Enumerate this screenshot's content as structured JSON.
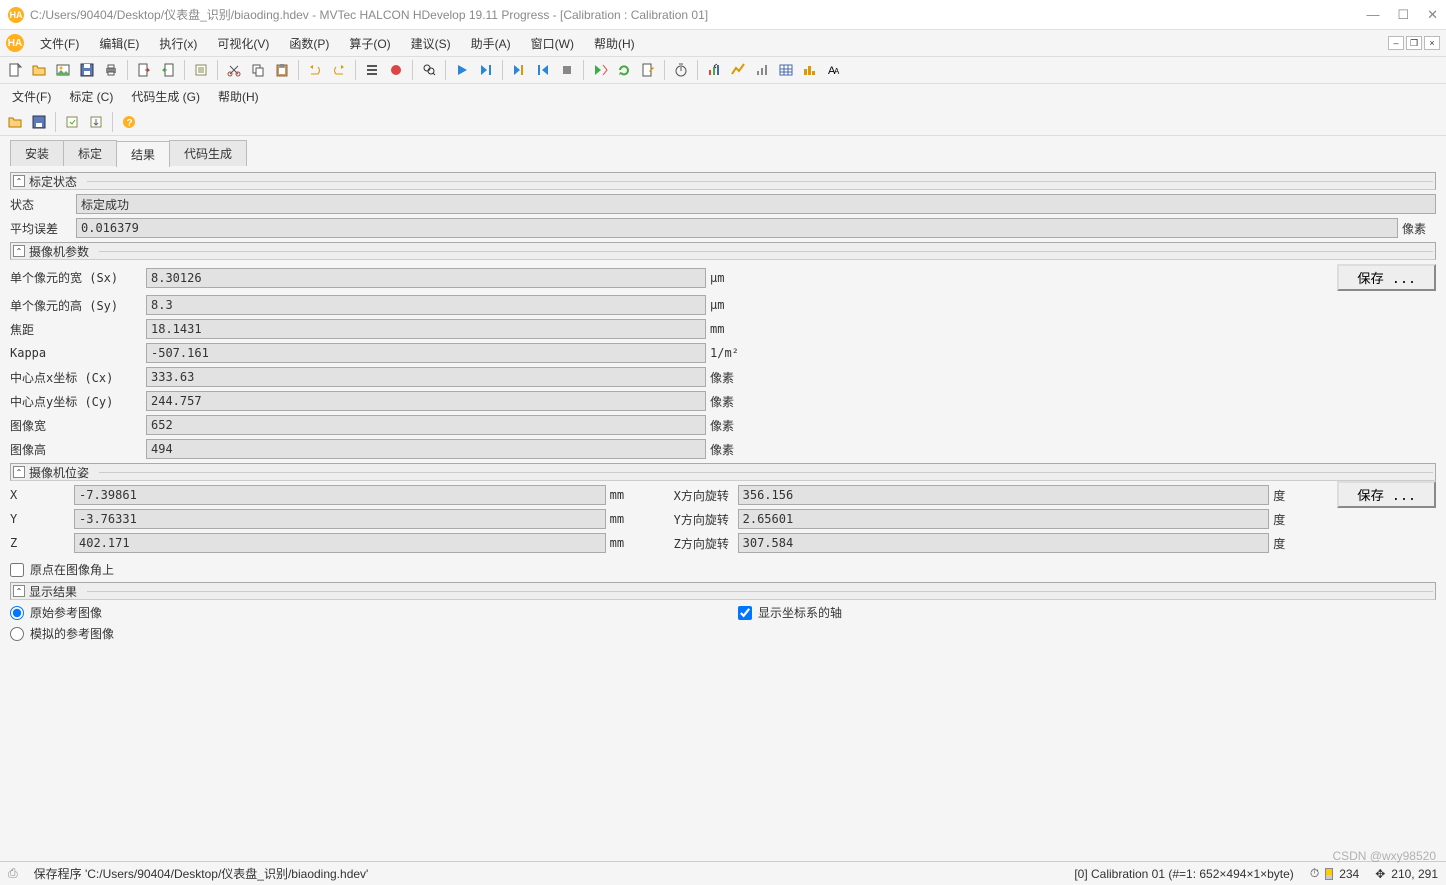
{
  "titlebar": {
    "title": "C:/Users/90404/Desktop/仪表盘_识别/biaoding.hdev - MVTec HALCON HDevelop 19.11 Progress - [Calibration : Calibration 01]"
  },
  "menus": {
    "file": "文件(F)",
    "edit": "编辑(E)",
    "exec": "执行(x)",
    "visual": "可视化(V)",
    "func": "函数(P)",
    "oper": "算子(O)",
    "suggest": "建议(S)",
    "assist": "助手(A)",
    "window": "窗口(W)",
    "help": "帮助(H)"
  },
  "submenu": {
    "file": "文件(F)",
    "calib": "标定 (C)",
    "codegen": "代码生成 (G)",
    "help": "帮助(H)"
  },
  "tabs": {
    "install": "安装",
    "calib": "标定",
    "result": "结果",
    "codegen": "代码生成"
  },
  "groups": {
    "calib_state": "标定状态",
    "cam_params": "摄像机参数",
    "cam_pose": "摄像机位姿",
    "display": "显示结果"
  },
  "state": {
    "label": "状态",
    "value": "标定成功",
    "err_label": "平均误差",
    "err_value": "0.016379",
    "err_unit": "像素"
  },
  "params": {
    "save": "保存 ...",
    "rows": [
      {
        "label": "单个像元的宽 (Sx)",
        "value": "8.30126",
        "unit": "μm"
      },
      {
        "label": "单个像元的高 (Sy)",
        "value": "8.3",
        "unit": "μm"
      },
      {
        "label": "焦距",
        "value": "18.1431",
        "unit": "mm"
      },
      {
        "label": "Kappa",
        "value": "-507.161",
        "unit": "1/m²"
      },
      {
        "label": "中心点x坐标 (Cx)",
        "value": "333.63",
        "unit": "像素"
      },
      {
        "label": "中心点y坐标 (Cy)",
        "value": "244.757",
        "unit": "像素"
      },
      {
        "label": "图像宽",
        "value": "652",
        "unit": "像素"
      },
      {
        "label": "图像高",
        "value": "494",
        "unit": "像素"
      }
    ]
  },
  "pose": {
    "save": "保存 ...",
    "left": [
      {
        "label": "X",
        "value": "-7.39861",
        "unit": "mm"
      },
      {
        "label": "Y",
        "value": "-3.76331",
        "unit": "mm"
      },
      {
        "label": "Z",
        "value": "402.171",
        "unit": "mm"
      }
    ],
    "right": [
      {
        "label": "X方向旋转",
        "value": "356.156",
        "unit": "度"
      },
      {
        "label": "Y方向旋转",
        "value": "2.65601",
        "unit": "度"
      },
      {
        "label": "Z方向旋转",
        "value": "307.584",
        "unit": "度"
      }
    ],
    "origin_corner": "原点在图像角上"
  },
  "display": {
    "orig": "原始参考图像",
    "sim": "模拟的参考图像",
    "axes": "显示坐标系的轴"
  },
  "status": {
    "msg": "保存程序 'C:/Users/90404/Desktop/仪表盘_识别/biaoding.hdev'",
    "info": "[0] Calibration 01 (#=1: 652×494×1×byte)",
    "t": "234",
    "coord": "210, 291"
  },
  "watermark": "CSDN @wxy98520"
}
